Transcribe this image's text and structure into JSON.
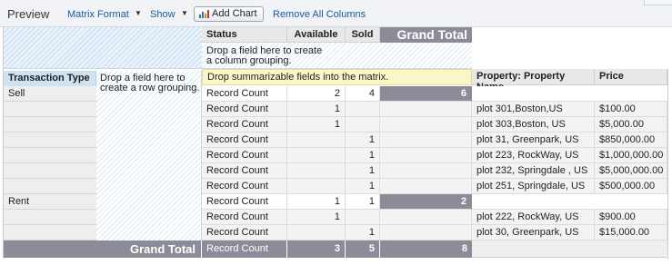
{
  "toolbar": {
    "title": "Preview",
    "matrix_format": "Matrix Format",
    "show": "Show",
    "add_chart": "Add Chart",
    "remove_all_columns": "Remove All Columns"
  },
  "matrix": {
    "status_label": "Status",
    "col_available": "Available",
    "col_sold": "Sold",
    "grand_total_header": "Grand Total",
    "drop_column_hint": "Drop a field here to create a column grouping.",
    "transaction_type_label": "Transaction Type",
    "drop_row_hint": "Drop a field here to create a row grouping.",
    "drop_summarizable_hint": "Drop summarizable fields into the matrix.",
    "property_name_header": "Property: Property Name",
    "price_header": "Price",
    "record_count_label": "Record Count",
    "groups": [
      {
        "name": "Sell",
        "subtotal": {
          "available": "2",
          "sold": "4",
          "total": "6"
        },
        "rows": [
          {
            "available": "1",
            "sold": "",
            "property": "plot 301,Boston,US",
            "price": "$100.00"
          },
          {
            "available": "1",
            "sold": "",
            "property": "plot 303,Boston, US",
            "price": "$5,000.00"
          },
          {
            "available": "",
            "sold": "1",
            "property": "plot 31, Greenpark, US",
            "price": "$850,000.00"
          },
          {
            "available": "",
            "sold": "1",
            "property": "plot 223, RockWay, US",
            "price": "$1,000,000.00"
          },
          {
            "available": "",
            "sold": "1",
            "property": "plot 232, Springdale , US",
            "price": "$5,000,000.00"
          },
          {
            "available": "",
            "sold": "1",
            "property": "plot 251, Springdale, US",
            "price": "$500,000.00"
          }
        ]
      },
      {
        "name": "Rent",
        "subtotal": {
          "available": "1",
          "sold": "1",
          "total": "2"
        },
        "rows": [
          {
            "available": "1",
            "sold": "",
            "property": "plot 222, RockWay, US",
            "price": "$900.00"
          },
          {
            "available": "",
            "sold": "1",
            "property": "plot 30, Greenpark, US",
            "price": "$15,000.00"
          }
        ]
      }
    ],
    "grand_total": {
      "label": "Grand Total",
      "record_count": "Record Count",
      "available": "3",
      "sold": "5",
      "total": "8"
    }
  }
}
